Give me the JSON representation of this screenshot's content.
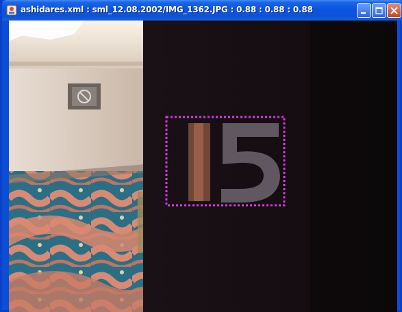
{
  "window": {
    "title": "ashidares.xml : sml_12.08.2002/IMG_1362.JPG : 0.88 : 0.88 : 0.88",
    "title_color": "#ffffff",
    "titlebar_color": "#0a55df"
  },
  "titlebar_buttons": [
    {
      "name": "minimize",
      "icon": "minimize-icon"
    },
    {
      "name": "maximize",
      "icon": "maximize-icon"
    },
    {
      "name": "close",
      "icon": "close-icon"
    }
  ],
  "photo": {
    "scene_text": "15",
    "annotation_color": "#d838e8"
  }
}
